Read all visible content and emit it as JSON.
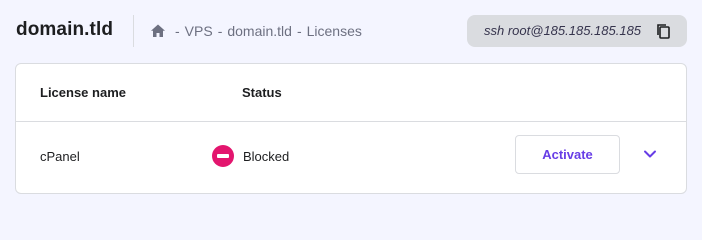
{
  "header": {
    "title": "domain.tld",
    "breadcrumb": {
      "home_icon": "home-icon",
      "items": [
        "VPS",
        "domain.tld",
        "Licenses"
      ],
      "separator": "-"
    },
    "ssh": {
      "command": "ssh root@185.185.185.185",
      "copy_icon": "copy-icon"
    }
  },
  "table": {
    "columns": [
      "License name",
      "Status"
    ],
    "rows": [
      {
        "name": "cPanel",
        "status": "Blocked",
        "status_icon": "blocked-icon",
        "status_color": "#e3156e",
        "action_label": "Activate",
        "expand_icon": "chevron-down-icon"
      }
    ]
  },
  "colors": {
    "accent": "#673de6",
    "blocked": "#e3156e",
    "background": "#f4f5ff"
  }
}
